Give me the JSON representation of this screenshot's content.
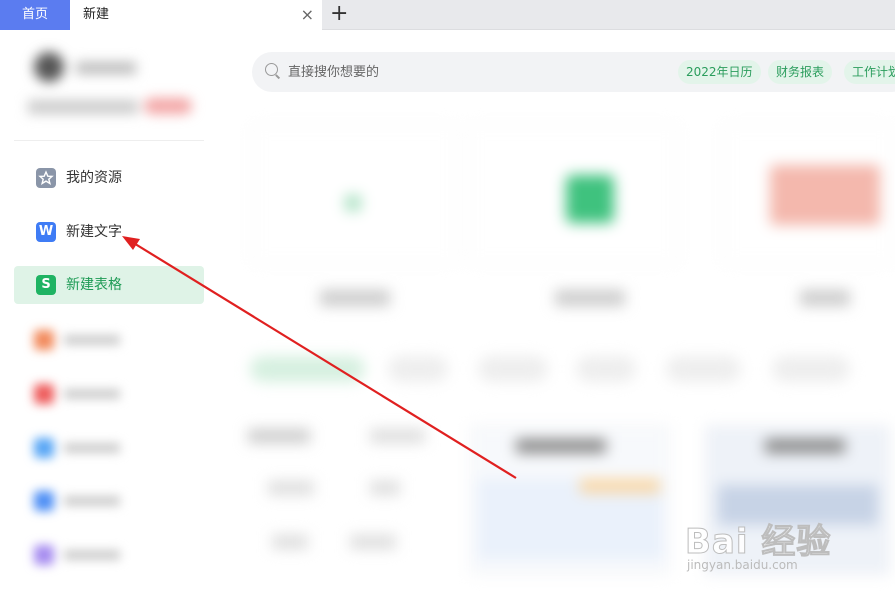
{
  "tabs": {
    "home_label": "首页",
    "new_label": "新建",
    "close_icon": "×",
    "add_icon": "+"
  },
  "sidebar": {
    "items": [
      {
        "label": "我的资源",
        "icon": "star-icon",
        "color": "#8a95a8"
      },
      {
        "label": "新建文字",
        "icon": "writer-icon",
        "glyph": "W",
        "color": "#3f7cf5"
      },
      {
        "label": "新建表格",
        "icon": "sheet-icon",
        "glyph": "S",
        "color": "#1fb363",
        "active": true
      }
    ]
  },
  "search": {
    "placeholder": "直接搜你想要的",
    "chips": [
      "2022年日历",
      "财务报表",
      "工作计划"
    ]
  },
  "watermark": {
    "brand": "Bai 经验",
    "sub": "jingyan.baidu.com"
  },
  "colors": {
    "accent_blue": "#5b7cf0",
    "active_green": "#1e9b55",
    "arrow_red": "#e02020"
  }
}
